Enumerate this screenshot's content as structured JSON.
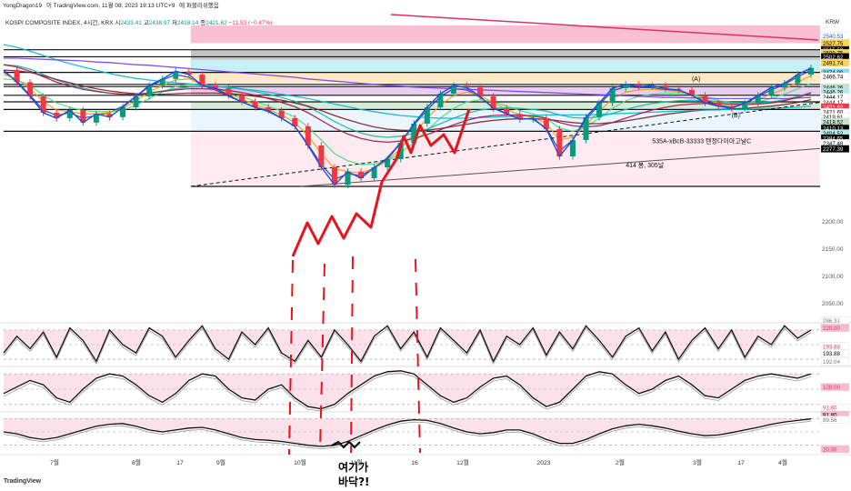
{
  "header": {
    "author": "YongDragon19",
    "published": "이 TradingView.com, 11월 08, 2023 19:13 UTC+9",
    "venue": "에 퍼블리쉬했음"
  },
  "symbol": {
    "name": "KOSPI COMPOSITE INDEX, 4시간, KRX",
    "open_label": "시",
    "open": "2433.41",
    "high_label": "고",
    "high": "2438.97",
    "low_label": "저",
    "low": "2418.14",
    "close_label": "종",
    "close": "2421.62",
    "change": "−11.53 (−0.47%)"
  },
  "logo": "TradingView",
  "colors": {
    "up": "#089981",
    "down": "#f23645",
    "price_tag": "#f23645",
    "annotation": "#e8131c"
  },
  "chart_data": {
    "type": "line",
    "currency": "KRW",
    "price_ticks": [
      "2200.00",
      "2150.00",
      "2100.00",
      "2050.00"
    ],
    "price_axis_labels": [
      {
        "v": 2540.53,
        "t": "2540.53",
        "fill": "#ffffff",
        "col": "#1a5fb4"
      },
      {
        "v": 2527.75,
        "t": "2527.75",
        "fill": "#ffd54f",
        "col": "#000000"
      },
      {
        "v": 2515.5,
        "t": "2515.50",
        "fill": "#000000",
        "col": "#ffffff"
      },
      {
        "v": 2509.75,
        "t": "2509.75",
        "fill": "#ffd54f",
        "col": "#000000"
      },
      {
        "v": 2502.62,
        "t": "2502.62",
        "fill": "#000000",
        "col": "#ffffff"
      },
      {
        "v": 2491.74,
        "t": "2491.74",
        "fill": "#ffd54f",
        "col": "#000000"
      },
      {
        "v": 2474.0,
        "t": "2474.00",
        "fill": "#80deea",
        "col": "#000000"
      },
      {
        "v": 2466.74,
        "t": "2466.74",
        "fill": "#ffffff",
        "col": "#000000"
      },
      {
        "v": 2446.26,
        "t": "2446.26",
        "fill": "#c8e6c9",
        "col": "#000000"
      },
      {
        "v": 2438.0,
        "t": "2446.26",
        "fill": "#b2ebf2",
        "col": "#000000"
      },
      {
        "v": 2429.0,
        "t": "2444.17",
        "fill": "#ffffff",
        "col": "#000000"
      },
      {
        "v": 2419.5,
        "t": "2444.17",
        "fill": "#ffffff",
        "col": "#000000"
      },
      {
        "v": 2410.5,
        "t": "2421.62",
        "fill": "#f23645",
        "col": "#ffffff"
      },
      {
        "v": 2401.5,
        "t": "2421.60",
        "fill": "#ffffff",
        "col": "#000000"
      },
      {
        "v": 2392.5,
        "t": "2419.61",
        "fill": "#ffffff",
        "col": "#000000"
      },
      {
        "v": 2383.5,
        "t": "2418.52",
        "fill": "#c8e6c9",
        "col": "#000000"
      },
      {
        "v": 2371.5,
        "t": "2410.13",
        "fill": "#000000",
        "col": "#ffffff"
      },
      {
        "v": 2362.5,
        "t": "2404.52",
        "fill": "#b2ebf2",
        "col": "#000000"
      },
      {
        "v": 2353.5,
        "t": "2384.65",
        "fill": "#000000",
        "col": "#ffffff"
      },
      {
        "v": 2344.5,
        "t": "2347.48",
        "fill": "#ffffff",
        "col": "#000000"
      },
      {
        "v": 2334.0,
        "t": "2277.39",
        "fill": "#000000",
        "col": "#ffffff"
      }
    ],
    "zones": [
      {
        "from": 2527.75,
        "to": 2560,
        "color": "#f8bbd0"
      },
      {
        "from": 2515.5,
        "to": 2527.75,
        "color": "#ffffff"
      },
      {
        "from": 2497,
        "to": 2515.5,
        "color": "#b0b0b0"
      },
      {
        "from": 2474,
        "to": 2497,
        "color": "#b2ebf2"
      },
      {
        "from": 2455,
        "to": 2474,
        "color": "#ffe0b2"
      },
      {
        "from": 2432,
        "to": 2448,
        "color": "#e1bee7"
      },
      {
        "from": 2408,
        "to": 2420,
        "color": "#c8e6c9"
      },
      {
        "from": 2366,
        "to": 2408,
        "color": "#e3f2fd"
      },
      {
        "from": 2265,
        "to": 2366,
        "color": "#fce4ec"
      }
    ],
    "levels": [
      2515.5,
      2502.62,
      2474.0,
      2452,
      2448,
      2432,
      2420,
      2406,
      2366,
      2265
    ],
    "x_labels": [
      "7월",
      "8월",
      "17",
      "9월",
      "10월",
      "11월",
      "16",
      "12월",
      "2023",
      "2월",
      "3월",
      "17",
      "4월"
    ],
    "price": [
      2478,
      2456,
      2430,
      2400,
      2390,
      2405,
      2382,
      2398,
      2392,
      2410,
      2430,
      2450,
      2462,
      2476,
      2470,
      2450,
      2445,
      2432,
      2420,
      2410,
      2404,
      2390,
      2375,
      2340,
      2300,
      2268,
      2292,
      2280,
      2300,
      2315,
      2345,
      2380,
      2410,
      2435,
      2450,
      2446,
      2430,
      2408,
      2398,
      2388,
      2390,
      2370,
      2320,
      2350,
      2392,
      2418,
      2445,
      2452,
      2448,
      2450,
      2444,
      2442,
      2432,
      2418,
      2412,
      2408,
      2418,
      2432,
      2446,
      2454,
      2470,
      2482
    ],
    "moving_averages": [
      {
        "color": "#1e40af",
        "values": [
          2475,
          2458,
          2432,
          2405,
          2395,
          2400,
          2390,
          2395,
          2400,
          2412,
          2430,
          2448,
          2460,
          2470,
          2465,
          2450,
          2442,
          2430,
          2420,
          2410,
          2402,
          2390,
          2375,
          2342,
          2305,
          2278,
          2288,
          2285,
          2298,
          2318,
          2345,
          2378,
          2405,
          2430,
          2444,
          2442,
          2428,
          2410,
          2398,
          2390,
          2388,
          2372,
          2330,
          2350,
          2388,
          2415,
          2440,
          2448,
          2446,
          2446,
          2442,
          2440,
          2432,
          2420,
          2414,
          2410,
          2416,
          2430,
          2442,
          2452,
          2466,
          2478
        ]
      },
      {
        "color": "#f59e0b",
        "values": [
          2470,
          2462,
          2445,
          2420,
          2405,
          2402,
          2398,
          2398,
          2400,
          2408,
          2422,
          2438,
          2450,
          2460,
          2462,
          2454,
          2446,
          2436,
          2425,
          2415,
          2406,
          2396,
          2382,
          2358,
          2325,
          2298,
          2292,
          2290,
          2298,
          2312,
          2335,
          2362,
          2390,
          2414,
          2432,
          2438,
          2432,
          2418,
          2406,
          2396,
          2392,
          2380,
          2350,
          2355,
          2378,
          2402,
          2426,
          2438,
          2442,
          2443,
          2441,
          2439,
          2434,
          2425,
          2418,
          2413,
          2415,
          2424,
          2434,
          2444,
          2456,
          2468
        ]
      },
      {
        "color": "#4ade80",
        "values": [
          2462,
          2460,
          2450,
          2432,
          2418,
          2410,
          2404,
          2402,
          2402,
          2405,
          2414,
          2426,
          2438,
          2448,
          2452,
          2450,
          2446,
          2438,
          2430,
          2421,
          2412,
          2403,
          2392,
          2374,
          2350,
          2325,
          2312,
          2305,
          2306,
          2312,
          2326,
          2346,
          2368,
          2390,
          2408,
          2420,
          2424,
          2420,
          2412,
          2404,
          2398,
          2390,
          2372,
          2366,
          2374,
          2390,
          2408,
          2422,
          2430,
          2434,
          2436,
          2436,
          2434,
          2428,
          2423,
          2418,
          2417,
          2420,
          2426,
          2434,
          2444,
          2454
        ]
      },
      {
        "color": "#14b8a6",
        "values": [
          2488,
          2486,
          2480,
          2470,
          2460,
          2452,
          2445,
          2440,
          2436,
          2434,
          2434,
          2436,
          2440,
          2444,
          2447,
          2448,
          2448,
          2446,
          2443,
          2439,
          2434,
          2428,
          2421,
          2411,
          2398,
          2384,
          2372,
          2363,
          2357,
          2355,
          2357,
          2362,
          2370,
          2380,
          2390,
          2399,
          2405,
          2408,
          2409,
          2408,
          2406,
          2403,
          2396,
          2391,
          2390,
          2393,
          2399,
          2406,
          2412,
          2417,
          2420,
          2422,
          2423,
          2422,
          2421,
          2419,
          2418,
          2418,
          2420,
          2424,
          2430,
          2437
        ]
      },
      {
        "color": "#7f1d1d",
        "values": [
          2478,
          2477,
          2474,
          2468,
          2461,
          2455,
          2449,
          2444,
          2440,
          2437,
          2435,
          2434,
          2434,
          2435,
          2436,
          2436,
          2436,
          2435,
          2433,
          2430,
          2427,
          2423,
          2418,
          2412,
          2404,
          2395,
          2387,
          2380,
          2374,
          2370,
          2368,
          2367,
          2368,
          2371,
          2375,
          2379,
          2383,
          2386,
          2388,
          2389,
          2389,
          2388,
          2385,
          2382,
          2380,
          2380,
          2382,
          2385,
          2389,
          2393,
          2397,
          2400,
          2403,
          2405,
          2406,
          2407,
          2408,
          2410,
          2412,
          2415,
          2419,
          2424
        ]
      },
      {
        "color": "#06b6d4",
        "values": [
          2525,
          2520,
          2513,
          2505,
          2497,
          2490,
          2484,
          2478,
          2472,
          2467,
          2463,
          2460,
          2457,
          2455,
          2453,
          2451,
          2449,
          2447,
          2444,
          2441,
          2438,
          2434,
          2430,
          2426,
          2421,
          2416,
          2411,
          2406,
          2402,
          2398,
          2395,
          2393,
          2391,
          2390,
          2390,
          2390,
          2391,
          2392,
          2393,
          2394,
          2395,
          2396,
          2396,
          2396,
          2396,
          2397,
          2398,
          2399,
          2400,
          2401,
          2402,
          2403,
          2404,
          2405,
          2405,
          2406,
          2406,
          2407,
          2408,
          2409,
          2410,
          2412
        ]
      },
      {
        "color": "#7c3aed",
        "values": [
          2500,
          2500,
          2499,
          2498,
          2497,
          2496,
          2495,
          2493,
          2492,
          2490,
          2488,
          2487,
          2485,
          2483,
          2481,
          2479,
          2477,
          2475,
          2473,
          2471,
          2469,
          2467,
          2465,
          2462,
          2460,
          2458,
          2456,
          2454,
          2452,
          2450,
          2449,
          2447,
          2446,
          2445,
          2444,
          2443,
          2442,
          2441,
          2440,
          2439,
          2438,
          2437,
          2436,
          2435,
          2434,
          2433,
          2432,
          2431,
          2430,
          2429,
          2428,
          2428,
          2427,
          2427,
          2426,
          2426,
          2426,
          2426,
          2426,
          2426,
          2427,
          2428
        ]
      },
      {
        "color": "#9d174d",
        "values": [
          2488,
          2484,
          2476,
          2466,
          2456,
          2449,
          2443,
          2439,
          2436,
          2434,
          2434,
          2436,
          2439,
          2442,
          2444,
          2444,
          2443,
          2441,
          2437,
          2432,
          2426,
          2419,
          2411,
          2400,
          2386,
          2372,
          2361,
          2353,
          2348,
          2346,
          2348,
          2353,
          2360,
          2369,
          2378,
          2386,
          2392,
          2395,
          2396,
          2396,
          2394,
          2390,
          2382,
          2376,
          2374,
          2376,
          2382,
          2390,
          2398,
          2405,
          2410,
          2414,
          2416,
          2417,
          2417,
          2416,
          2415,
          2416,
          2418,
          2422,
          2428,
          2436
        ]
      }
    ],
    "trendline": [
      [
        0,
        2265
      ],
      [
        62,
        2420
      ]
    ],
    "chart_texts": [
      {
        "t": "(A)",
        "i": 52,
        "v": 2458
      },
      {
        "t": "(B)",
        "i": 55,
        "v": 2392
      },
      {
        "t": "414 봉, 305날",
        "i": 47,
        "v": 2300
      },
      {
        "t": "535A-xBcB-33333 텐정다이아고날C",
        "i": 49,
        "v": 2344
      }
    ],
    "annotation": {
      "text_1": "여기가",
      "text_2": "바닥?!"
    },
    "oscillators": [
      {
        "labels": [
          {
            "t": "220.00",
            "k": 0.1,
            "fill": "#f8bbd0",
            "col": "#f23645"
          },
          {
            "t": "193.88",
            "k": 0.54,
            "fill": "#ffffff",
            "col": "#f23645"
          },
          {
            "t": "193.88",
            "k": 0.71,
            "fill": "#ffffff",
            "col": "#000000"
          },
          {
            "t": "192.04",
            "k": 0.9,
            "fill": "#ffffff",
            "col": "#777777"
          },
          {
            "t": "286.31",
            "k": -0.08,
            "fill": "#ffffff",
            "col": "#777777"
          }
        ],
        "values": [
          0.3,
          0.7,
          0.4,
          0.8,
          0.2,
          0.9,
          0.6,
          0.1,
          0.85,
          0.5,
          0.3,
          0.9,
          0.7,
          0.2,
          0.6,
          0.95,
          0.4,
          0.15,
          0.8,
          0.5,
          0.9,
          0.3,
          0.1,
          0.6,
          0.2,
          0.85,
          0.5,
          0.1,
          0.7,
          0.95,
          0.4,
          0.8,
          0.2,
          0.9,
          0.6,
          0.3,
          0.85,
          0.1,
          0.7,
          0.5,
          0.9,
          0.25,
          0.8,
          0.4,
          0.95,
          0.6,
          0.2,
          0.7,
          0.9,
          0.35,
          0.8,
          0.15,
          0.6,
          0.9,
          0.4,
          0.85,
          0.2,
          0.7,
          0.5,
          0.95,
          0.65,
          0.85
        ]
      },
      {
        "labels": [
          {
            "t": "120.00",
            "k": 0.45,
            "fill": "#f8bbd0",
            "col": "#f23645"
          },
          {
            "t": "91.80",
            "k": 0.92,
            "fill": "#ffffff",
            "col": "#f23645"
          }
        ],
        "values": [
          0.4,
          0.55,
          0.7,
          0.6,
          0.3,
          0.2,
          0.5,
          0.75,
          0.85,
          0.8,
          0.6,
          0.35,
          0.2,
          0.4,
          0.7,
          0.85,
          0.8,
          0.5,
          0.3,
          0.25,
          0.5,
          0.6,
          0.3,
          0.1,
          0.05,
          0.15,
          0.4,
          0.6,
          0.8,
          0.9,
          0.92,
          0.85,
          0.6,
          0.35,
          0.2,
          0.3,
          0.55,
          0.75,
          0.8,
          0.6,
          0.3,
          0.1,
          0.2,
          0.5,
          0.8,
          0.9,
          0.85,
          0.6,
          0.4,
          0.5,
          0.7,
          0.8,
          0.6,
          0.35,
          0.3,
          0.5,
          0.7,
          0.8,
          0.85,
          0.8,
          0.75,
          0.85
        ]
      },
      {
        "labels": [
          {
            "t": "91.80",
            "k": 0.05,
            "fill": "#f8bbd0",
            "col": "#000000"
          },
          {
            "t": "89.56",
            "k": 0.18,
            "fill": "#ffffff",
            "col": "#777777"
          },
          {
            "t": "20.00",
            "k": 0.95,
            "fill": "#f8bbd0",
            "col": "#f23645"
          }
        ],
        "values": [
          0.5,
          0.45,
          0.35,
          0.3,
          0.35,
          0.45,
          0.55,
          0.65,
          0.7,
          0.72,
          0.65,
          0.55,
          0.5,
          0.55,
          0.6,
          0.62,
          0.55,
          0.45,
          0.35,
          0.3,
          0.28,
          0.25,
          0.2,
          0.15,
          0.12,
          0.15,
          0.25,
          0.4,
          0.55,
          0.68,
          0.78,
          0.82,
          0.8,
          0.72,
          0.6,
          0.5,
          0.45,
          0.48,
          0.55,
          0.55,
          0.45,
          0.3,
          0.2,
          0.2,
          0.3,
          0.45,
          0.58,
          0.66,
          0.7,
          0.66,
          0.6,
          0.52,
          0.45,
          0.4,
          0.42,
          0.48,
          0.55,
          0.62,
          0.7,
          0.76,
          0.8,
          0.84
        ]
      }
    ]
  }
}
